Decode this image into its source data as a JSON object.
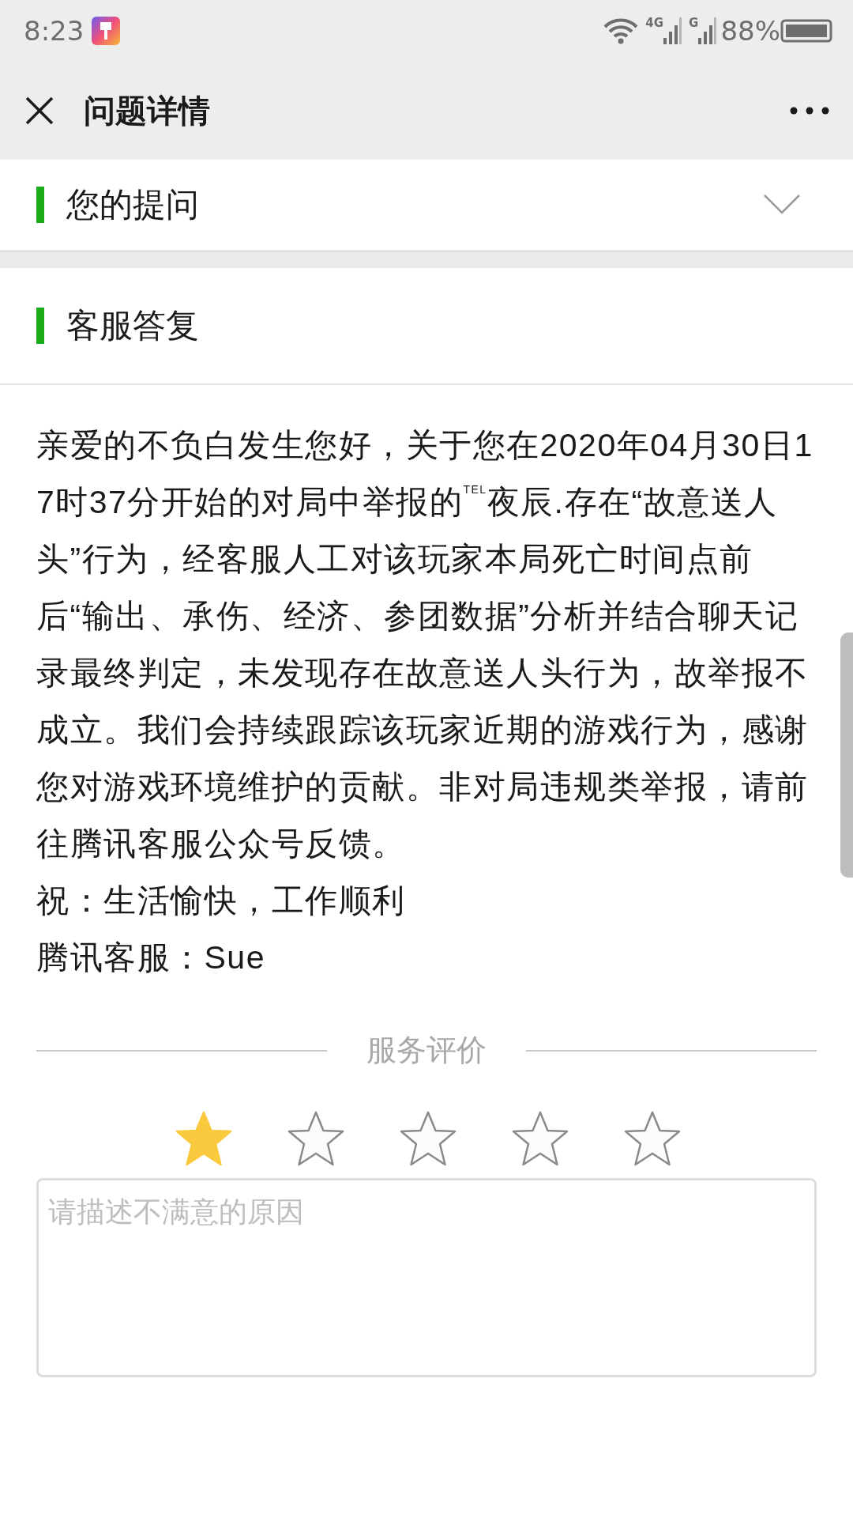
{
  "status_bar": {
    "time": "8:23",
    "networks": [
      "4G",
      "G"
    ],
    "battery": "88%"
  },
  "nav": {
    "title": "问题详情"
  },
  "sections": [
    {
      "title": "您的提问",
      "expanded": false
    },
    {
      "title": "客服答复"
    }
  ],
  "reply": [
    "亲爱的不负白发生您好，关于您在2020年04月30日17时37分开始的对局中举报的$^{TEL}$夜辰.存在“故意送人头”行为，经客服人工对该玩家本局死亡时间点前后“输出、承伤、经济、参团数据”分析并结合聊天记录最终判定，未发现存在故意送人头行为，故举报不成立。我们会持续跟踪该玩家近期的游戏行为，感谢您对游戏环境维护的贡献。非对局违规类举报，请前往腾讯客服公众号反馈。",
    "祝：生活愉快，工作顺利",
    "腾讯客服：Sue"
  ],
  "rating": {
    "title": "服务评价",
    "stars": 1,
    "placeholder": "请描述不满意的原因"
  }
}
